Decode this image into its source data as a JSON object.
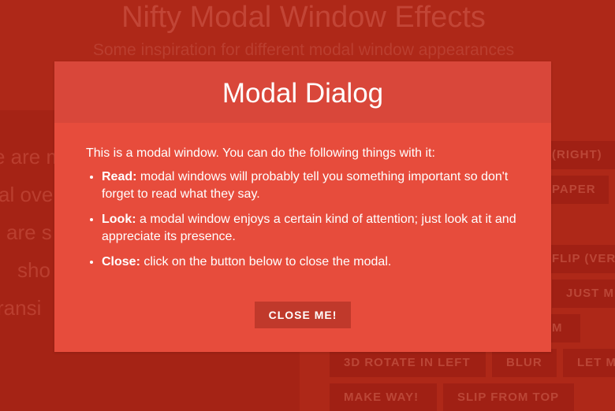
{
  "page": {
    "title": "Nifty Modal Window Effects",
    "subtitle": "Some inspiration for different modal window appearances",
    "left_text": [
      "e are m",
      "al ove",
      "are s",
      "sho",
      "ransi"
    ],
    "buttons": [
      {
        "label": "(RIGHT)"
      },
      {
        "label": "PAPER"
      },
      {
        "label": "FLIP (VER"
      },
      {
        "label": "JUST M"
      },
      {
        "label": "M"
      },
      {
        "label": "3D ROTATE IN LEFT"
      },
      {
        "label": "BLUR"
      },
      {
        "label": "LET M"
      },
      {
        "label": "MAKE WAY!"
      },
      {
        "label": "SLIP FROM TOP"
      }
    ]
  },
  "modal": {
    "title": "Modal Dialog",
    "intro": "This is a modal window. You can do the following things with it:",
    "items": [
      {
        "label": "Read:",
        "text": " modal windows will probably tell you something important so don't forget to read what they say."
      },
      {
        "label": "Look:",
        "text": " a modal window enjoys a certain kind of attention; just look at it and appreciate its presence."
      },
      {
        "label": "Close:",
        "text": " click on the button below to close the modal."
      }
    ],
    "close_label": "CLOSE ME!"
  },
  "colors": {
    "modal_bg": "#e74c3c",
    "modal_header": "#d9473a",
    "close_button": "#c0392b",
    "page_bg": "#c4321f"
  }
}
